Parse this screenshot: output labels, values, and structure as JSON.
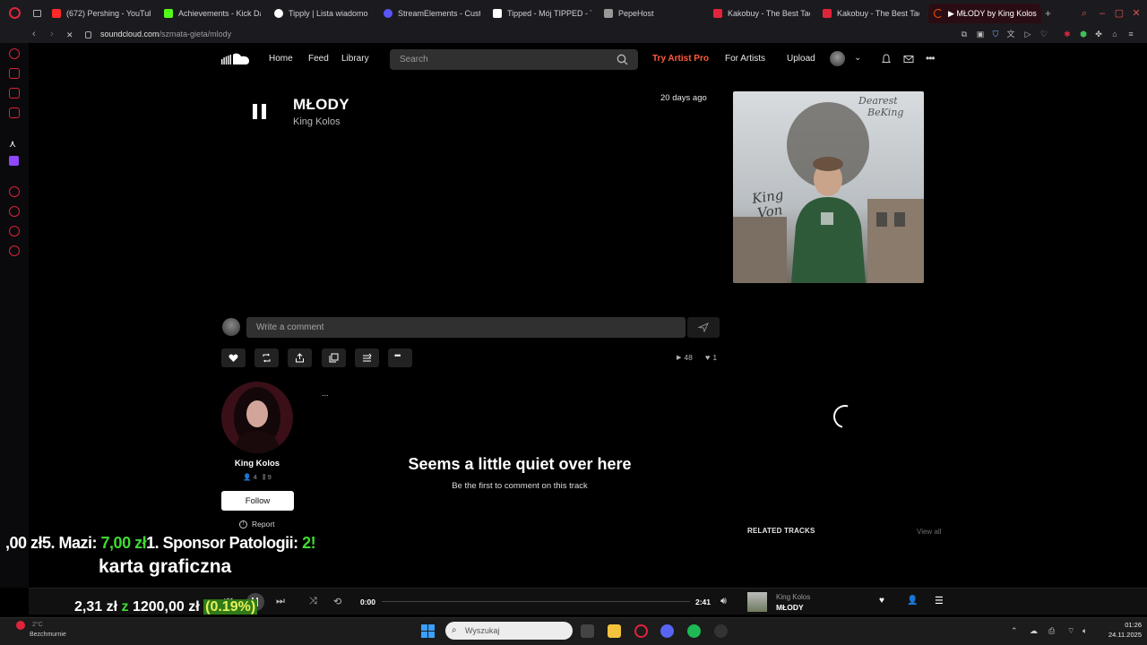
{
  "browser": {
    "tabs": [
      {
        "label": "(672) Pershing - YouTub",
        "color": "#ff2a2a",
        "icon": "youtube-icon"
      },
      {
        "label": "Achievements - Kick Da",
        "color": "#53fc18",
        "icon": "kick-icon"
      },
      {
        "label": "Tipply | Lista wiadomo",
        "color": "#ffffff",
        "icon": "tipply-icon"
      },
      {
        "label": "StreamElements - Custo",
        "color": "#5a55ff",
        "icon": "streamelements-icon"
      },
      {
        "label": "Tipped - Mój TIPPED - T",
        "color": "#ffffff",
        "icon": "tipped-icon"
      },
      {
        "label": "PepeHost",
        "color": "#999999",
        "icon": "pepehost-icon"
      },
      {
        "label": "Kakobuy - The Best Tao",
        "color": "#e0243c",
        "icon": "kakobuy-icon"
      },
      {
        "label": "Kakobuy - The Best Tao",
        "color": "#e0243c",
        "icon": "kakobuy-icon"
      },
      {
        "label": "▶ MŁODY by King Kolos",
        "color": "#ff5500",
        "icon": "loading-icon"
      }
    ],
    "url_host": "soundcloud.com",
    "url_path": "/szmata-gieta/mlody"
  },
  "header": {
    "nav": [
      "Home",
      "Feed",
      "Library"
    ],
    "search_placeholder": "Search",
    "try_pro": "Try Artist Pro",
    "for_artists": "For Artists",
    "upload": "Upload",
    "accent": "#ff5500"
  },
  "track": {
    "title": "MŁODY",
    "artist": "King Kolos",
    "age": "20 days ago",
    "plays": "48",
    "likes": "1"
  },
  "comment": {
    "placeholder": "Write a comment"
  },
  "artist_card": {
    "name": "King Kolos",
    "followers": "4",
    "tracks": "9",
    "follow_label": "Follow",
    "report_label": "Report",
    "more": "..."
  },
  "empty_state": {
    "title": "Seems a little quiet over here",
    "subtitle": "Be the first to comment on this track"
  },
  "related": {
    "title": "RELATED TRACKS",
    "view_all": "View all"
  },
  "overlay": {
    "donations_prefix": ",00 zł5. Mazi: ",
    "donations_amount": "7,00 zł",
    "donations_rest": "1. Sponsor Patologii: ",
    "donations_tail": "2!",
    "title": "karta graficzna",
    "goal_current": "2,31 zł",
    "goal_sep": "z",
    "goal_target": "1200,00 zł",
    "goal_percent": "(0.19%)",
    "goal_fraction": 0.0019
  },
  "player": {
    "current_time": "0:00",
    "duration": "2:41",
    "progress_fraction": 0.0,
    "artist": "King Kolos",
    "title": "MŁODY"
  },
  "taskbar": {
    "weather": "Bezchmurnie",
    "weather_temp": "2°C",
    "search_placeholder": "Wyszukaj",
    "time": "01:26",
    "date": "24.11.2025"
  }
}
